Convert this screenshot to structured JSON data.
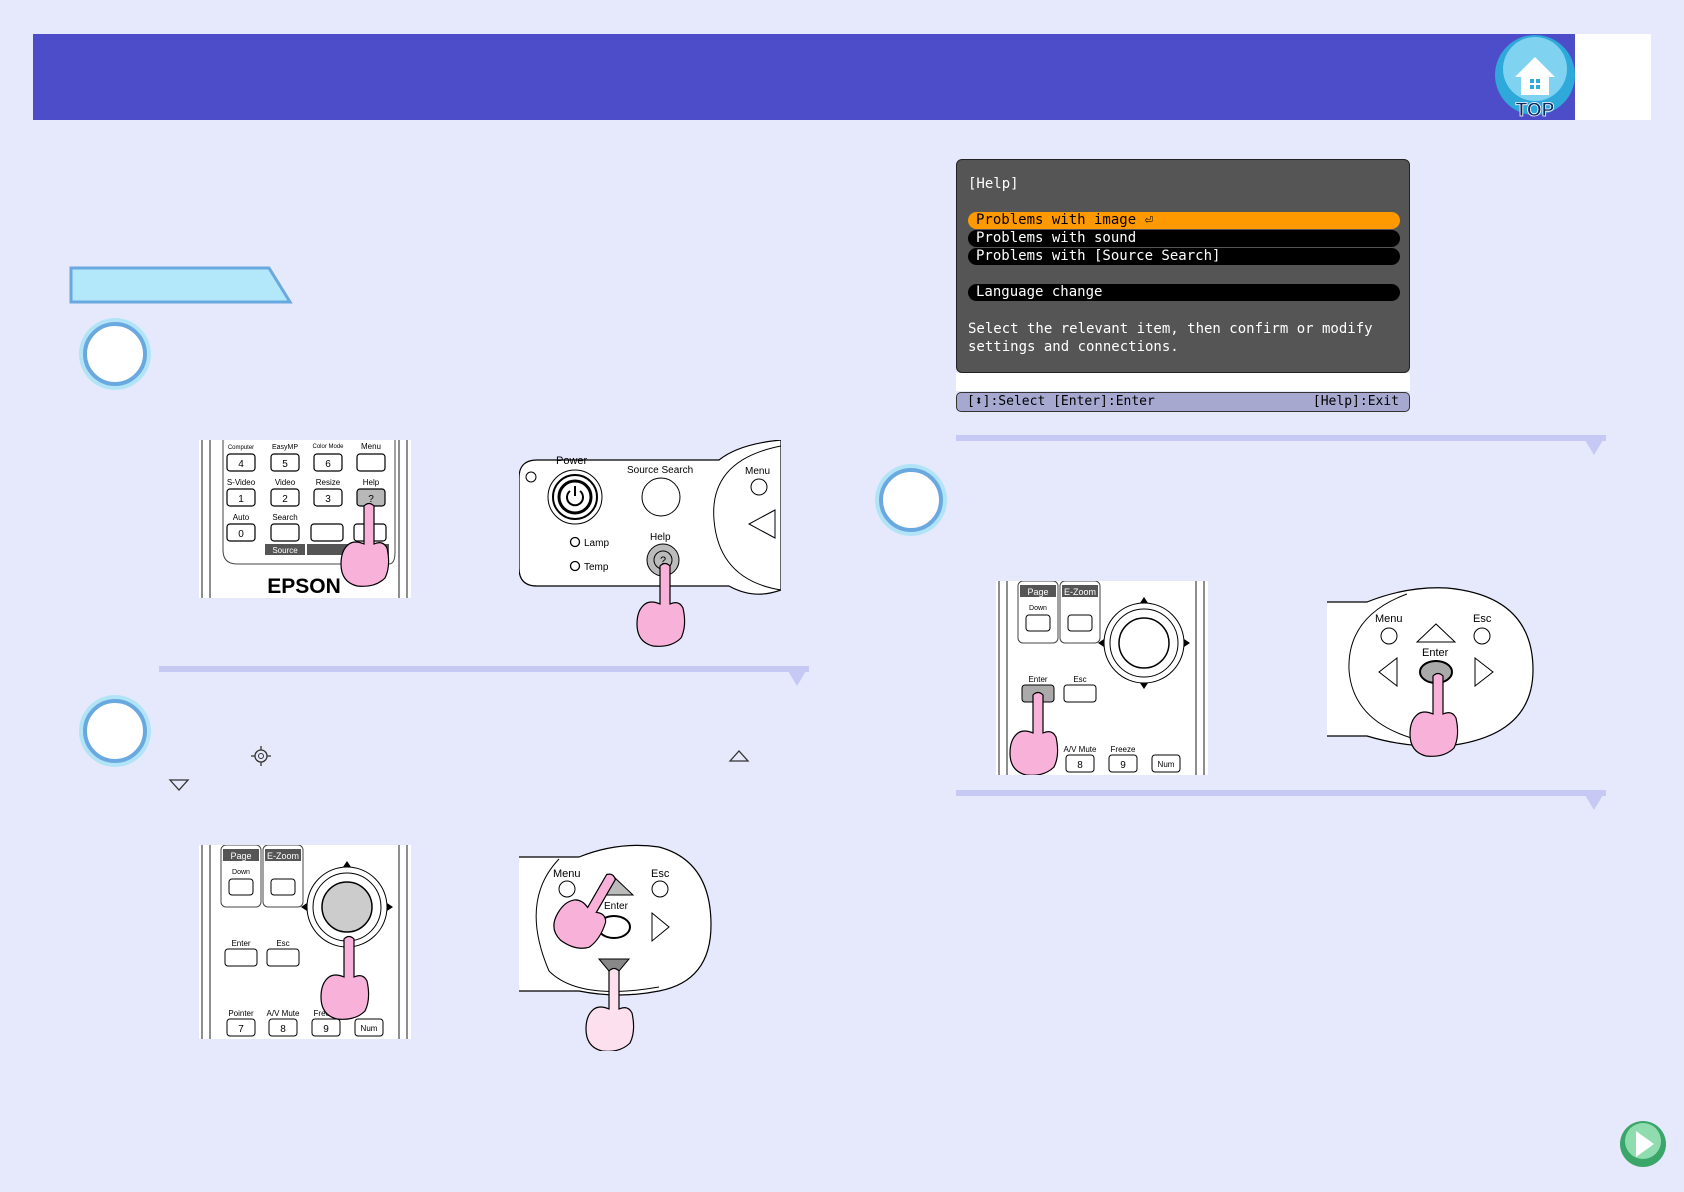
{
  "header": {
    "top_label": "TOP",
    "accent": "#4d4dc9"
  },
  "help_menu": {
    "title": "[Help]",
    "items": [
      {
        "label": "Problems with image",
        "selected": true
      },
      {
        "label": "Problems with sound",
        "selected": false
      },
      {
        "label": "Problems with [Source Search]",
        "selected": false
      },
      {
        "label": "Language change",
        "selected": false
      }
    ],
    "description": "Select the relevant item, then confirm or modify settings and connections.",
    "footer_left": "[⬍]:Select [Enter]:Enter",
    "footer_right": "[Help]:Exit"
  },
  "remote_help": {
    "row1": [
      "Computer",
      "EasyMP",
      "Color Mode",
      "Menu"
    ],
    "row1_keys": [
      "4",
      "5",
      "6",
      ""
    ],
    "row2": [
      "S-Video",
      "Video",
      "Resize",
      "Help"
    ],
    "row2_keys": [
      "1",
      "2",
      "3",
      "?"
    ],
    "row3": [
      "Auto",
      "Search"
    ],
    "row3_keys": [
      "0",
      ""
    ],
    "source_label": "Source",
    "brand": "EPSON"
  },
  "panel_help": {
    "power": "Power",
    "source_search": "Source Search",
    "menu": "Menu",
    "help": "Help",
    "lamp": "Lamp",
    "temp": "Temp"
  },
  "remote_nav": {
    "page": "Page",
    "down": "Down",
    "ezoom": "E-Zoom",
    "enter": "Enter",
    "esc": "Esc",
    "pointer": "Pointer",
    "avmute": "A/V Mute",
    "freeze": "Freeze",
    "key7": "7",
    "key8": "8",
    "key9": "9",
    "num": "Num"
  },
  "panel_nav": {
    "menu": "Menu",
    "esc": "Esc",
    "enter": "Enter"
  }
}
